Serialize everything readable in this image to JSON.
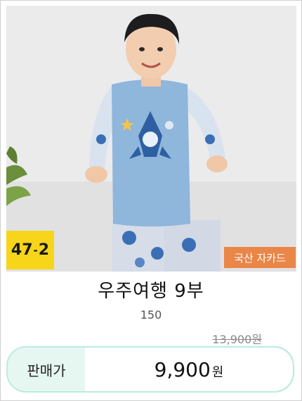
{
  "product": {
    "lot_number": "47",
    "lot_sub": "2",
    "origin_badge": "국산 자카드",
    "title": "우주여행 9부",
    "size": "150",
    "original_price": "13,900원",
    "sale_label": "판매가",
    "sale_price": "9,900",
    "sale_unit": "원"
  },
  "colors": {
    "lot_badge": "#f6d51a",
    "origin_badge": "#e98648",
    "price_box_border": "#b9ece0",
    "price_box_bg": "#e6f7f2"
  }
}
